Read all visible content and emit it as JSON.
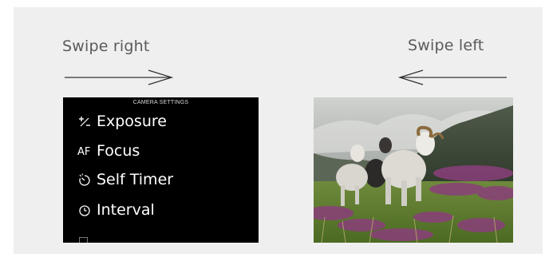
{
  "captions": {
    "left": "Swipe right",
    "right": "Swipe left"
  },
  "camera_screen": {
    "title": "CAMERA SETTINGS",
    "items": [
      {
        "label": "Exposure",
        "icon": "exposure-compensation-icon"
      },
      {
        "label": "Focus",
        "icon": "af-icon",
        "icon_text": "AF"
      },
      {
        "label": "Self Timer",
        "icon": "self-timer-icon"
      },
      {
        "label": "Interval",
        "icon": "clock-icon"
      }
    ]
  },
  "photo": {
    "subject": "sheep-photo"
  },
  "colors": {
    "panel": "#efefef",
    "caption": "#5a5a5a",
    "screen": "#000000"
  }
}
